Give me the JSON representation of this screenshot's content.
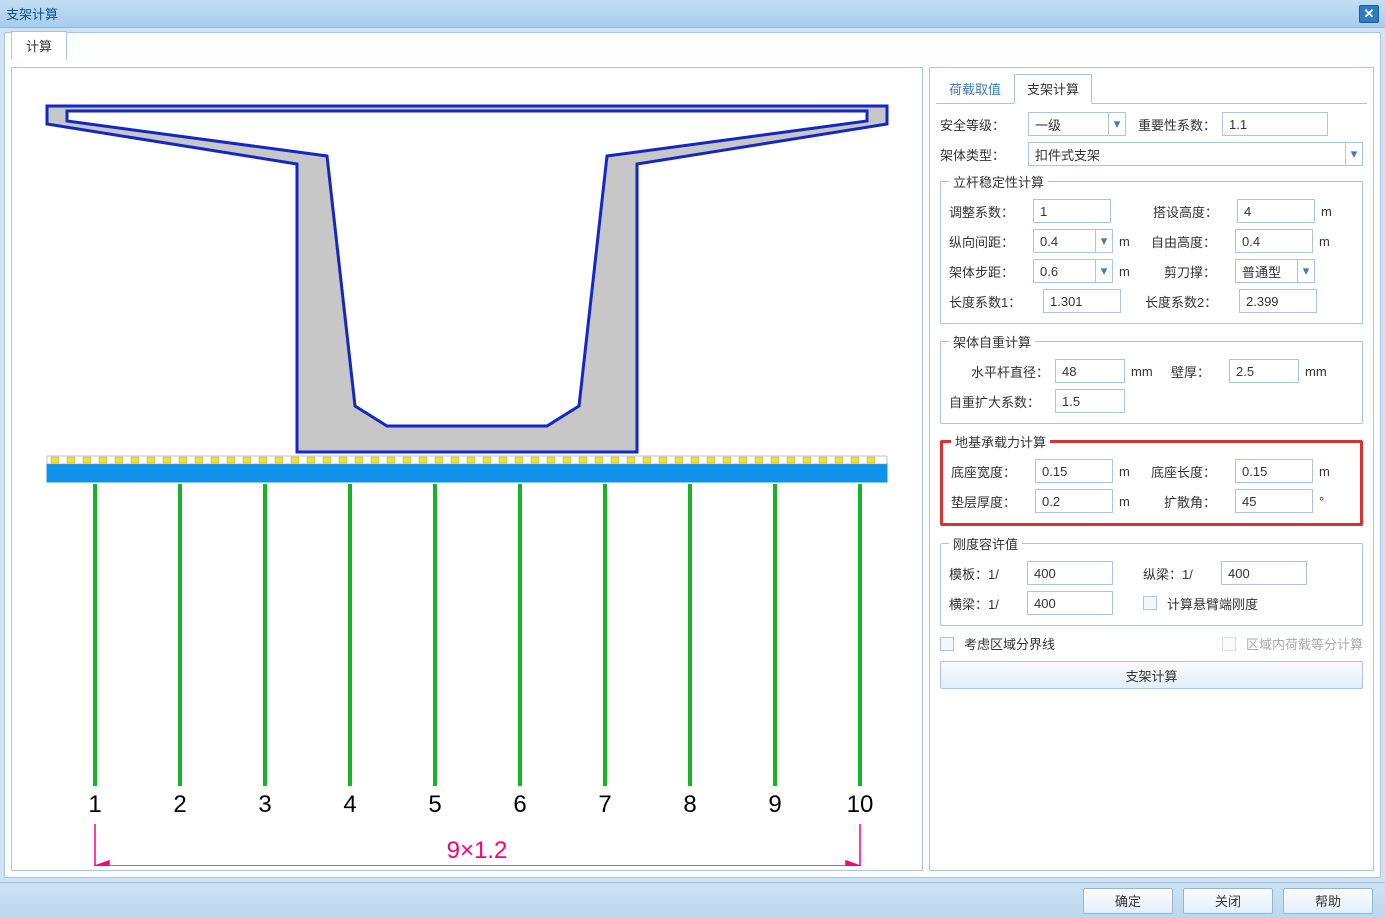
{
  "window": {
    "title": "支架计算"
  },
  "top_tab": "计算",
  "side_tabs": {
    "tab1": "荷载取值",
    "tab2": "支架计算"
  },
  "form": {
    "safety_level_label": "安全等级：",
    "safety_level": "一级",
    "importance_label": "重要性系数：",
    "importance": "1.1",
    "frame_type_label": "架体类型：",
    "frame_type": "扣件式支架",
    "group_upright": {
      "legend": "立杆稳定性计算",
      "adjust_label": "调整系数：",
      "adjust": "1",
      "height_label": "搭设高度：",
      "height": "4",
      "height_unit": "m",
      "long_label": "纵向间距：",
      "long": "0.4",
      "long_unit": "m",
      "free_label": "自由高度：",
      "free": "0.4",
      "free_unit": "m",
      "step_label": "架体步距：",
      "step": "0.6",
      "step_unit": "m",
      "scissor_label": "剪刀撑：",
      "scissor": "普通型",
      "len1_label": "长度系数1：",
      "len1": "1.301",
      "len2_label": "长度系数2：",
      "len2": "2.399"
    },
    "group_selfwt": {
      "legend": "架体自重计算",
      "hdiam_label": "水平杆直径：",
      "hdiam": "48",
      "hdiam_unit": "mm",
      "thick_label": "壁厚：",
      "thick": "2.5",
      "thick_unit": "mm",
      "amp_label": "自重扩大系数：",
      "amp": "1.5"
    },
    "group_foundation": {
      "legend": "地基承载力计算",
      "bw_label": "底座宽度：",
      "bw": "0.15",
      "bw_unit": "m",
      "bl_label": "底座长度：",
      "bl": "0.15",
      "bl_unit": "m",
      "pt_label": "垫层厚度：",
      "pt": "0.2",
      "pt_unit": "m",
      "ang_label": "扩散角：",
      "ang": "45",
      "ang_unit": "°"
    },
    "group_stiff": {
      "legend": "刚度容许值",
      "formwork_label": "模板：1/",
      "formwork": "400",
      "longb_label": "纵梁：1/",
      "longb": "400",
      "crossb_label": "横梁：1/",
      "crossb": "400",
      "cantilever_label": "计算悬臂端刚度"
    },
    "consider_region_label": "考虑区域分界线",
    "region_equal_label": "区域内荷载等分计算",
    "compute_btn": "支架计算"
  },
  "footer": {
    "ok": "确定",
    "close": "关闭",
    "help": "帮助"
  },
  "diagram": {
    "axis_labels": [
      "1",
      "2",
      "3",
      "4",
      "5",
      "6",
      "7",
      "8",
      "9",
      "10"
    ],
    "dim": "9×1.2"
  }
}
